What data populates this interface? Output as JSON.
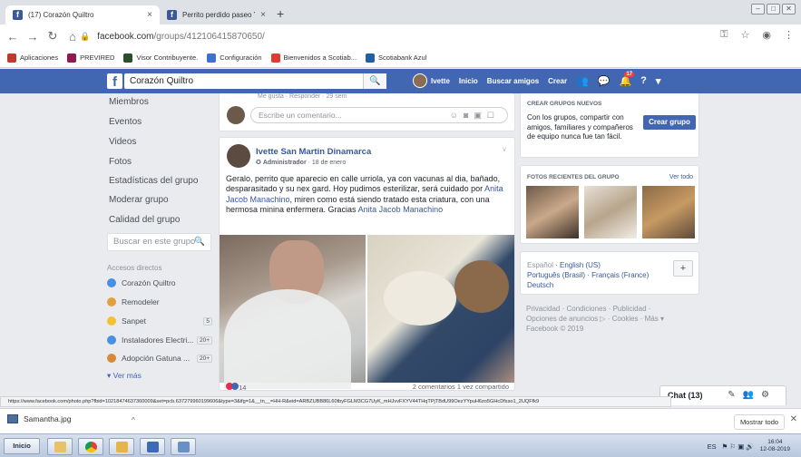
{
  "browser": {
    "tabs": [
      {
        "title": "(17) Corazón Quiltro",
        "close": "×"
      },
      {
        "title": "Perrito perdido paseo Yugoslavo - fr",
        "close": "×"
      }
    ],
    "new_tab": "+",
    "url_host": "facebook.com",
    "url_path": "/groups/412106415870650/",
    "bookmarks": [
      {
        "label": "Aplicaciones",
        "color": "#c0392b"
      },
      {
        "label": "PREVIRED",
        "color": "#8e1b4f"
      },
      {
        "label": "Visor Contribuyente.",
        "color": "#2d4e2a"
      },
      {
        "label": "Configuración",
        "color": "#3f6fd1"
      },
      {
        "label": "Bienvenidos a Scotiab...",
        "color": "#e03c31"
      },
      {
        "label": "Scotiabank Azul",
        "color": "#1f5fa8"
      }
    ]
  },
  "fb": {
    "search_value": "Corazón Quiltro",
    "user": "Ivette",
    "nav": [
      "Inicio",
      "Buscar amigos",
      "Crear"
    ],
    "notif_count": "17",
    "brand_color": "#4267b2"
  },
  "left": {
    "items": [
      "Miembros",
      "Eventos",
      "Videos",
      "Fotos",
      "Estadísticas del grupo",
      "Moderar grupo",
      "Calidad del grupo"
    ],
    "group_search_placeholder": "Buscar en este grupo",
    "shortcuts_title": "Accesos directos",
    "shortcuts": [
      {
        "label": "Corazón Quiltro",
        "count": "",
        "color": "#4a90e2"
      },
      {
        "label": "Remodeler",
        "count": "",
        "color": "#e0a040"
      },
      {
        "label": "Sanpet",
        "count": "5",
        "color": "#f2c230"
      },
      {
        "label": "Instaladores Electri...",
        "count": "20+",
        "color": "#4a90e2"
      },
      {
        "label": "Adopción Gatuna ...",
        "count": "20+",
        "color": "#d9893a"
      }
    ],
    "see_more": "Ver más"
  },
  "comment": {
    "ghost": "Me gusta · Responder · 29 sem",
    "placeholder": "Escribe un comentario..."
  },
  "post": {
    "author": "Ivette San Martin Dinamarca",
    "role": "Administrador",
    "date": "18 de enero",
    "text_a": "Geralo, perrito que aparecio en calle urriola, ya con vacunas al dia, bañado, desparasitado y su nex gard. Hoy pudimos esterilizar, será cuidado por ",
    "link_a": "Anita Jacob Manachino",
    "text_b": ", miren como está siendo tratado esta criatura, con una hermosa minina enfermera. Gracias ",
    "link_b": "Anita Jacob Manachino",
    "reactions": "14",
    "comments": "2 comentarios  1 vez compartido"
  },
  "right": {
    "create_title": "CREAR GRUPOS NUEVOS",
    "create_text": "Con los grupos, compartir con amigos, familiares y compañeros de equipo nunca fue tan fácil.",
    "create_btn": "Crear grupo",
    "photos_title": "FOTOS RECIENTES DEL GRUPO",
    "photos_link": "Ver todo",
    "lang_line1_a": "Español",
    "lang_line1_b": "English (US)",
    "lang_line2_a": "Português (Brasil)",
    "lang_line2_b": "Français (France)",
    "lang_line3": "Deutsch",
    "footer1": "Privacidad · Condiciones · Publicidad ·",
    "footer2": "Opciones de anuncios ▷ · Cookies · Más ▾",
    "footer3": "Facebook © 2019"
  },
  "status_url": "https://www.facebook.com/photo.php?fbid=10218474637360009&set=pcb.637279960199606&type=3&ifg=1&__tn__=HH-R&eid=ARBZUBB86L60tbyFGLM3CG7UyK_mHJvvFXYV44THqTPjTBdU99OezYYpuH6zo5GHcDfsso1_2UQFfk9",
  "chat": {
    "label": "Chat (13)"
  },
  "download": {
    "file": "Samantha.jpg",
    "show_all": "Mostrar todo"
  },
  "taskbar": {
    "start": "Inicio",
    "lang": "ES",
    "time": "16:04",
    "date": "12-08-2019"
  }
}
